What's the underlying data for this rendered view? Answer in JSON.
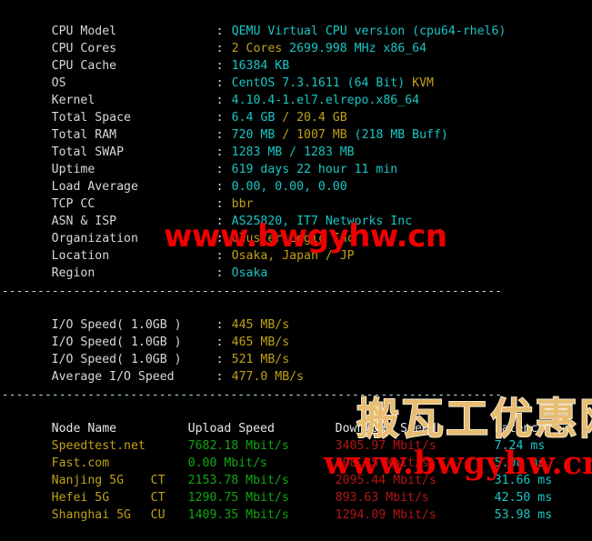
{
  "terminal": {
    "background": "#000000",
    "colors": {
      "label": "#d8d8d8",
      "cyan": "#19c5c5",
      "yellow": "#c0a017",
      "green": "#0fa60f",
      "red": "#b51515",
      "separator": "#bfe9ea",
      "watermark_red": "#ee0000",
      "watermark_gold": "#e8bd72"
    },
    "separator": "----------------------------------------------------------------------"
  },
  "sysinfo": [
    {
      "label": "CPU Model",
      "separator": ":",
      "value": "QEMU Virtual CPU version (cpu64-rhel6)",
      "parts": [
        {
          "text": "QEMU Virtual CPU version (cpu64-rhel6)",
          "color": "cyan"
        }
      ]
    },
    {
      "label": "CPU Cores",
      "separator": ":",
      "value": "2 Cores 2699.998 MHz x86_64",
      "parts": [
        {
          "text": "2 Cores ",
          "color": "yellow"
        },
        {
          "text": "2699.998 MHz x86_64",
          "color": "cyan"
        }
      ]
    },
    {
      "label": "CPU Cache",
      "separator": ":",
      "value": "16384 KB",
      "parts": [
        {
          "text": "16384 KB",
          "color": "cyan"
        }
      ]
    },
    {
      "label": "OS",
      "separator": ":",
      "value": "CentOS 7.3.1611 (64 Bit) KVM",
      "parts": [
        {
          "text": "CentOS 7.3.1611 (64 Bit) ",
          "color": "cyan"
        },
        {
          "text": "KVM",
          "color": "yellow"
        }
      ]
    },
    {
      "label": "Kernel",
      "separator": ":",
      "value": "4.10.4-1.el7.elrepo.x86_64",
      "parts": [
        {
          "text": "4.10.4-1.el7.elrepo.x86_64",
          "color": "cyan"
        }
      ]
    },
    {
      "label": "Total Space",
      "separator": ":",
      "value": "6.4 GB / 20.4 GB",
      "parts": [
        {
          "text": "6.4 GB ",
          "color": "cyan"
        },
        {
          "text": "/ 20.4 GB",
          "color": "yellow"
        }
      ]
    },
    {
      "label": "Total RAM",
      "separator": ":",
      "value": "720 MB / 1007 MB (218 MB Buff)",
      "parts": [
        {
          "text": "720 MB ",
          "color": "cyan"
        },
        {
          "text": "/ 1007 MB ",
          "color": "yellow"
        },
        {
          "text": "(218 MB Buff)",
          "color": "cyan"
        }
      ]
    },
    {
      "label": "Total SWAP",
      "separator": ":",
      "value": "1283 MB / 1283 MB",
      "parts": [
        {
          "text": "1283 MB / 1283 MB",
          "color": "cyan"
        }
      ]
    },
    {
      "label": "Uptime",
      "separator": ":",
      "value": "619 days 22 hour 11 min",
      "parts": [
        {
          "text": "619 days 22 hour 11 min",
          "color": "cyan"
        }
      ]
    },
    {
      "label": "Load Average",
      "separator": ":",
      "value": "0.00, 0.00, 0.00",
      "parts": [
        {
          "text": "0.00, 0.00, 0.00",
          "color": "cyan"
        }
      ]
    },
    {
      "label": "TCP CC",
      "separator": ":",
      "value": "bbr",
      "parts": [
        {
          "text": "bbr",
          "color": "yellow"
        }
      ]
    },
    {
      "label": "ASN & ISP",
      "separator": ":",
      "value": "AS25820, IT7 Networks Inc",
      "parts": [
        {
          "text": "AS25820, IT7 Networks Inc",
          "color": "cyan"
        }
      ]
    },
    {
      "label": "Organization",
      "separator": ":",
      "value": "Cluster Logic Inc",
      "parts": [
        {
          "text": "Cluster Logic Inc",
          "color": "yellow"
        }
      ]
    },
    {
      "label": "Location",
      "separator": ":",
      "value": "Osaka, Japan / JP",
      "parts": [
        {
          "text": "Osaka, Japan / JP",
          "color": "yellow"
        }
      ]
    },
    {
      "label": "Region",
      "separator": ":",
      "value": "Osaka",
      "parts": [
        {
          "text": "Osaka",
          "color": "cyan"
        }
      ]
    }
  ],
  "iospeed": [
    {
      "label": "I/O Speed( 1.0GB )",
      "separator": ":",
      "value": "445 MB/s"
    },
    {
      "label": "I/O Speed( 1.0GB )",
      "separator": ":",
      "value": "465 MB/s"
    },
    {
      "label": "I/O Speed( 1.0GB )",
      "separator": ":",
      "value": "521 MB/s"
    },
    {
      "label": "Average I/O Speed",
      "separator": ":",
      "value": "477.0 MB/s"
    }
  ],
  "speedtest": {
    "headers": {
      "node": "Node Name",
      "tag": "",
      "upload": "Upload Speed",
      "download": "Download Speed",
      "latency": "Latency"
    },
    "rows": [
      {
        "node": "Speedtest.net",
        "tag": "",
        "upload": "7682.18 Mbit/s",
        "download": "3405.97 Mbit/s",
        "latency": "7.24 ms"
      },
      {
        "node": "Fast.com",
        "tag": "",
        "upload": "0.00 Mbit/s",
        "download": "208.25 Mbit/s",
        "latency": "5.08 ms"
      },
      {
        "node": "Nanjing 5G",
        "tag": "CT",
        "upload": "2153.78 Mbit/s",
        "download": "2095.44 Mbit/s",
        "latency": "31.66 ms"
      },
      {
        "node": "Hefei 5G",
        "tag": "CT",
        "upload": "1290.75 Mbit/s",
        "download": "893.63 Mbit/s",
        "latency": "42.50 ms"
      },
      {
        "node": "Shanghai 5G",
        "tag": "CU",
        "upload": "1409.35 Mbit/s",
        "download": "1294.09 Mbit/s",
        "latency": "53.98 ms"
      }
    ]
  },
  "watermarks": {
    "middle_url": "www.bwgyhw.cn",
    "chinese": "搬瓦工优惠网",
    "bottom_url": "www.bwgyhw.cn"
  }
}
